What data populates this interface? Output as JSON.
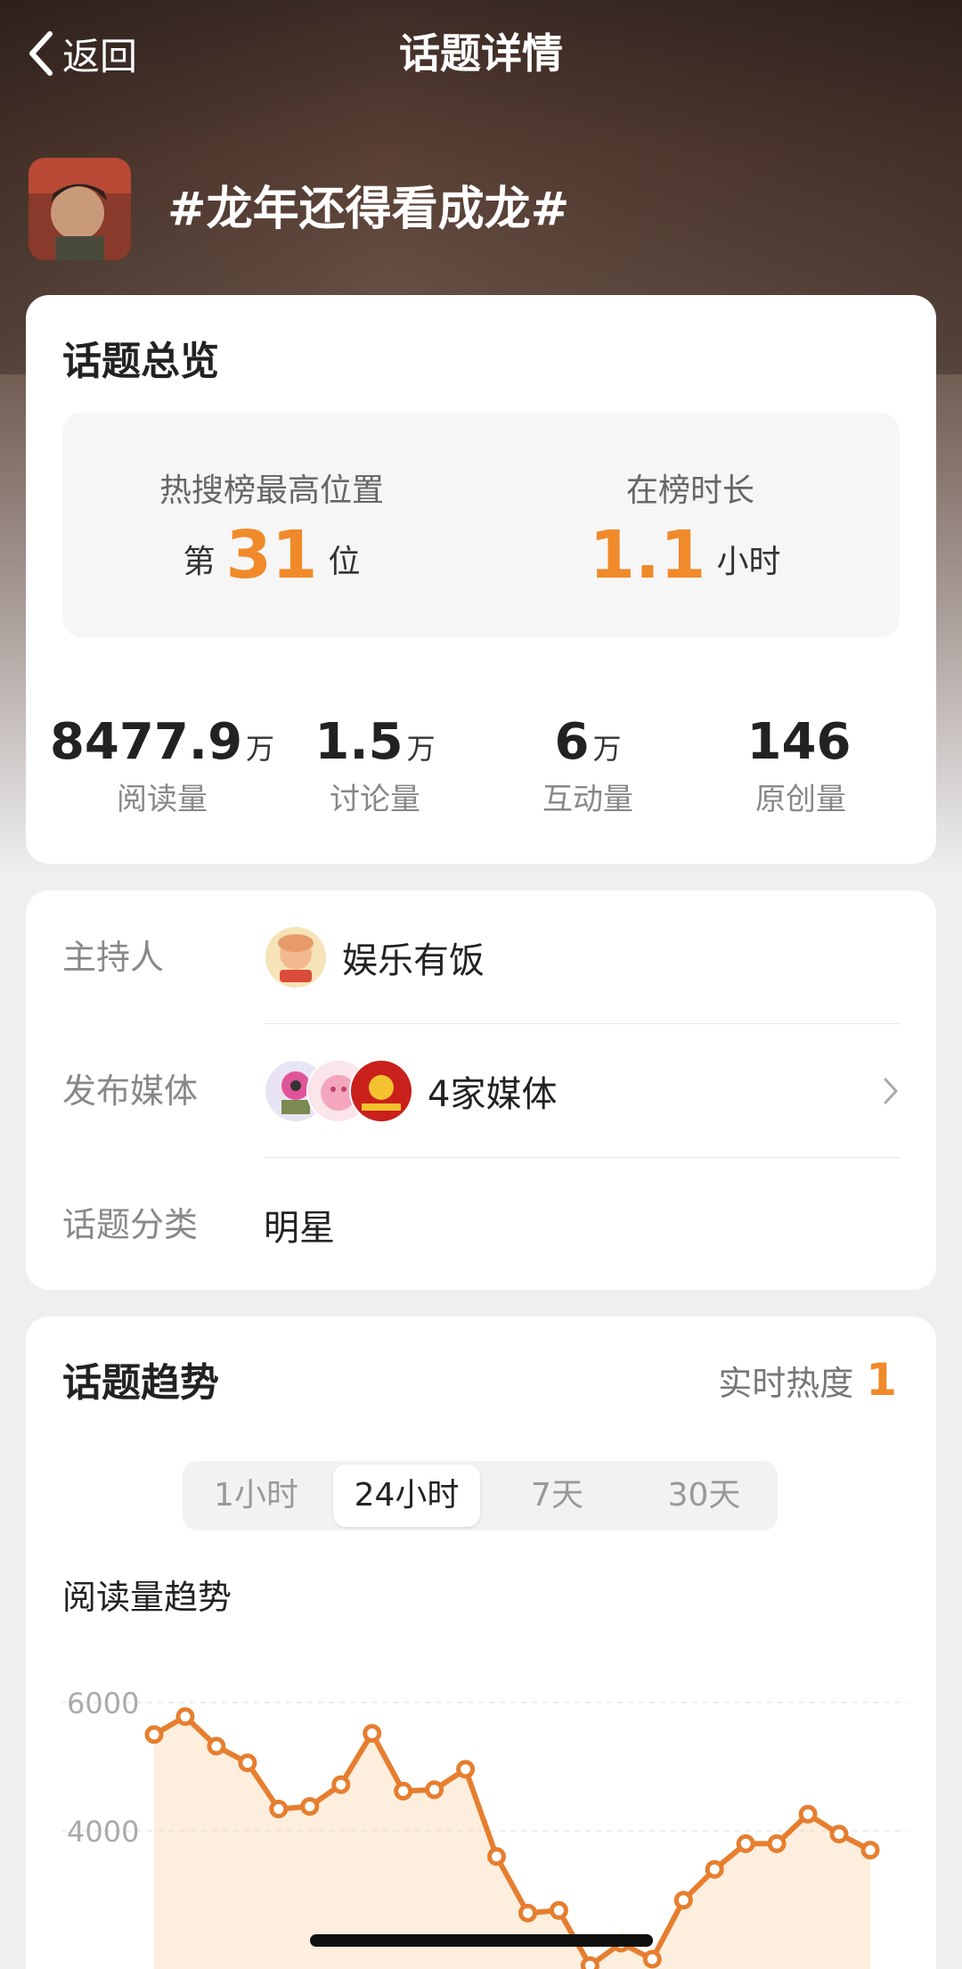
{
  "header": {
    "back_label": "返回",
    "title": "话题详情"
  },
  "topic": {
    "name": "#龙年还得看成龙#"
  },
  "overview": {
    "title": "话题总览",
    "peak_rank_label": "热搜榜最高位置",
    "peak_rank_prefix": "第",
    "peak_rank_value": "31",
    "peak_rank_suffix": "位",
    "duration_label": "在榜时长",
    "duration_value": "1.1",
    "duration_unit": "小时",
    "stats": [
      {
        "value": "8477.9",
        "unit": "万",
        "label": "阅读量"
      },
      {
        "value": "1.5",
        "unit": "万",
        "label": "讨论量"
      },
      {
        "value": "6",
        "unit": "万",
        "label": "互动量"
      },
      {
        "value": "146",
        "unit": "",
        "label": "原创量"
      }
    ]
  },
  "info": {
    "host_label": "主持人",
    "host_name": "娱乐有饭",
    "media_label": "发布媒体",
    "media_value": "4家媒体",
    "category_label": "话题分类",
    "category_value": "明星"
  },
  "trend": {
    "title": "话题趋势",
    "realtime_label": "实时热度",
    "realtime_value": "1",
    "tabs": [
      "1小时",
      "24小时",
      "7天",
      "30天"
    ],
    "active_tab": 1,
    "subtitle": "阅读量趋势"
  },
  "colors": {
    "accent": "#f08a2a",
    "line": "#e67e2f",
    "area": "#fdeedd"
  },
  "chart_data": {
    "type": "area",
    "ylim": [
      2000,
      6000
    ],
    "y_ticks": [
      "6000",
      "4000"
    ],
    "values": [
      5500,
      5780,
      5320,
      5060,
      4340,
      4380,
      4720,
      5520,
      4620,
      4640,
      4960,
      3600,
      2720,
      2760,
      1900,
      2250,
      2000,
      2920,
      3400,
      3800,
      3800,
      4260,
      3950,
      3700
    ]
  }
}
